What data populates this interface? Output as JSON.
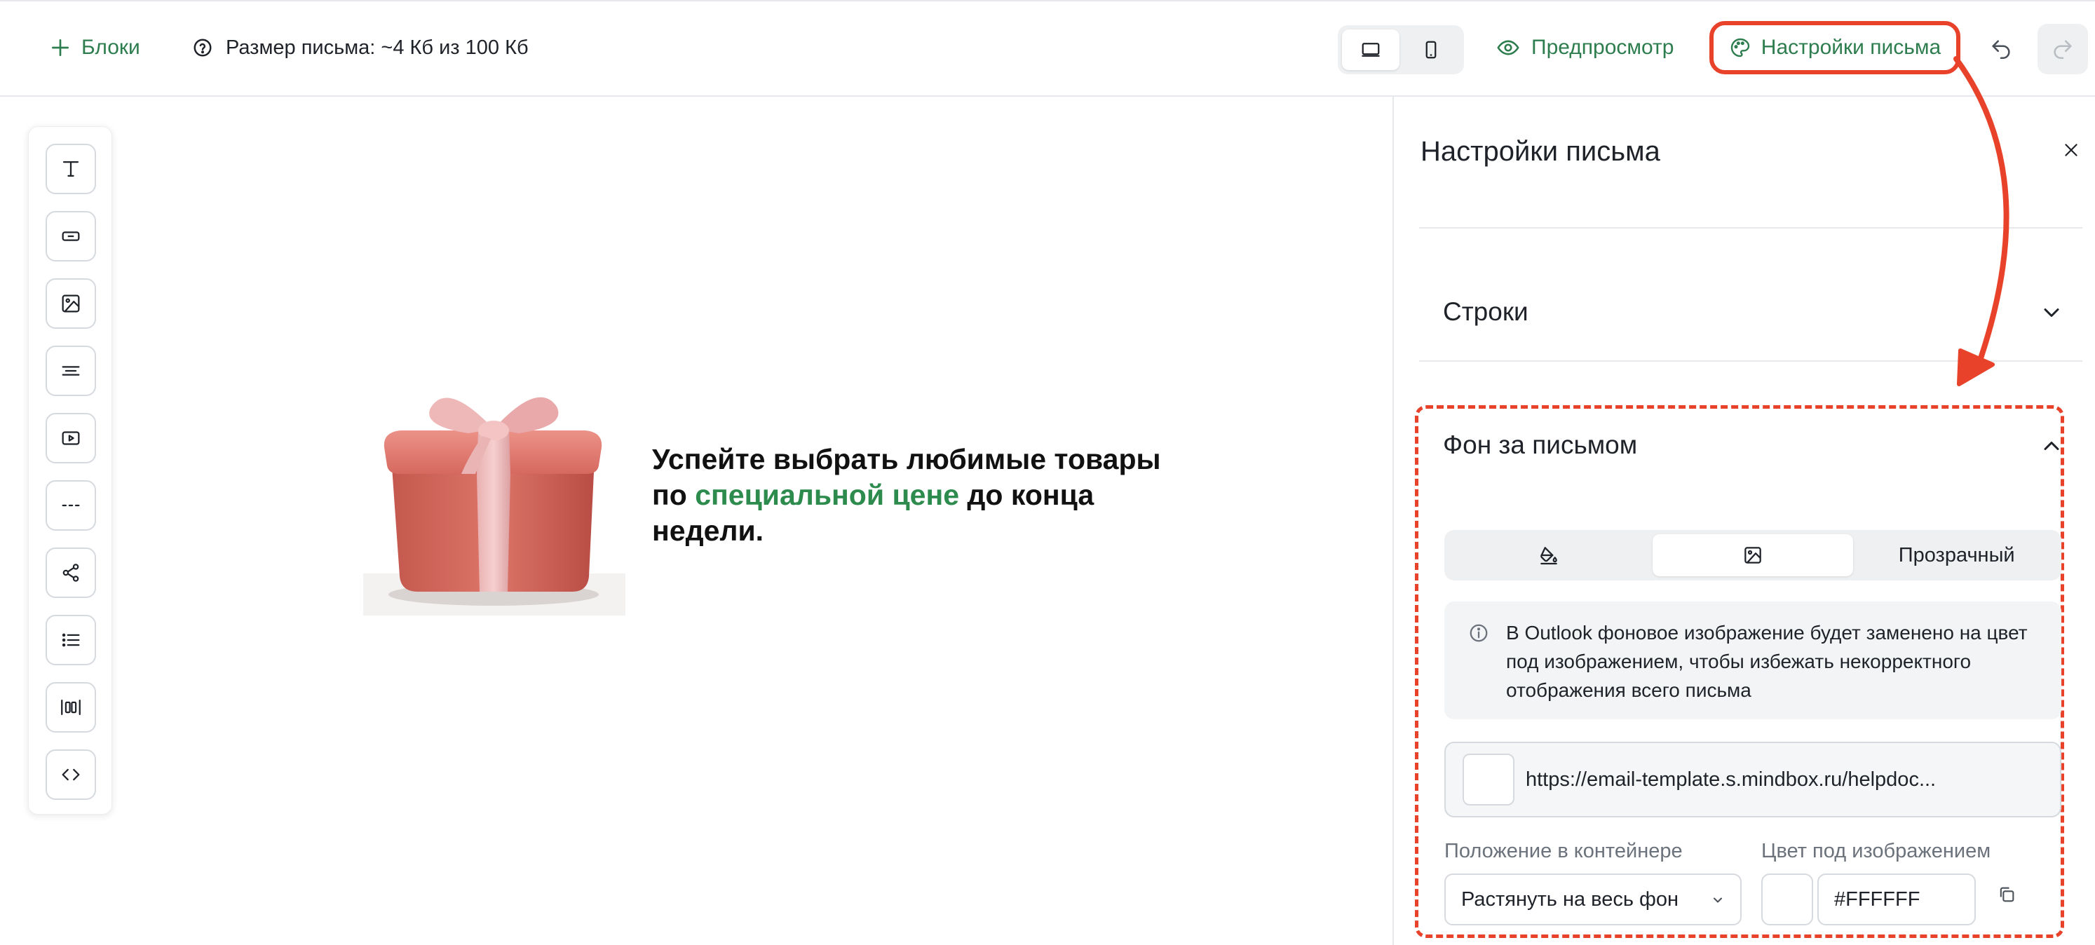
{
  "toolbar": {
    "blocks_label": "Блоки",
    "size_label": "Размер письма: ~4 Кб из 100 Кб",
    "preview_label": "Предпросмотр",
    "settings_label": "Настройки письма",
    "device_selected": "desktop"
  },
  "palette": {
    "tools": [
      "text-tool",
      "button-tool",
      "image-tool",
      "menu-tool",
      "video-tool",
      "divider-tool",
      "social-tool",
      "list-tool",
      "columns-tool",
      "code-tool"
    ]
  },
  "canvas": {
    "headline_part1": "Успейте выбрать любимые товары по ",
    "headline_accent": "специальной цене",
    "headline_part2": " до конца недели."
  },
  "panel": {
    "title": "Настройки письма",
    "rows_section": "Строки",
    "background_section": "Фон за письмом",
    "bg_tabs": {
      "transparent_label": "Прозрачный",
      "selected": "image"
    },
    "info_text": "В Outlook фоновое изображение будет заменено на цвет под изображением, чтобы избежать некорректного отображения всего письма",
    "image_url": "https://email-template.s.mindbox.ru/helpdoc...",
    "position_label": "Положение в контейнере",
    "position_value": "Растянуть на весь фон",
    "color_label": "Цвет под изображением",
    "color_value": "#FFFFFF"
  },
  "colors": {
    "accent_green": "#2e7d4f",
    "annotation_red": "#e8422b"
  }
}
